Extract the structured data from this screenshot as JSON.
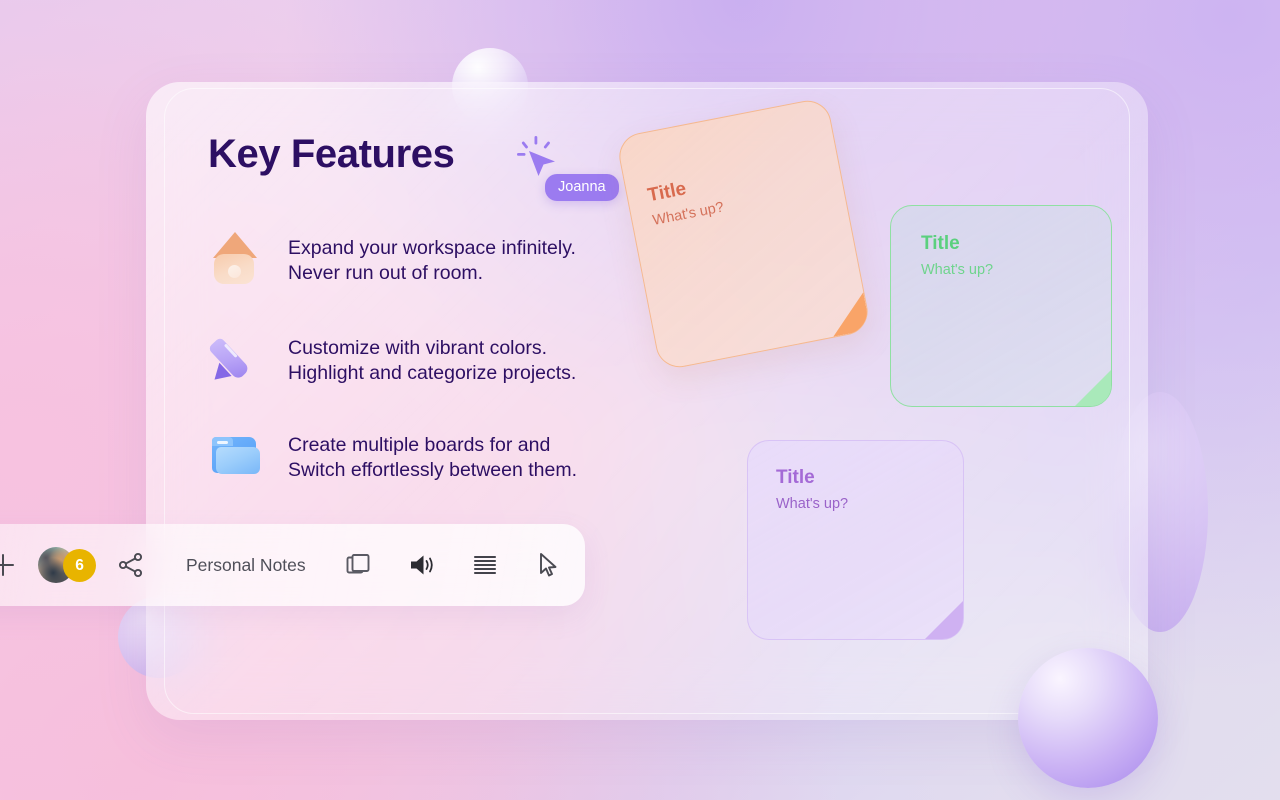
{
  "canvas": {
    "title": "Key Features",
    "features": [
      {
        "icon": "house-icon",
        "text": "Expand your workspace infinitely.\nNever run out of room."
      },
      {
        "icon": "pencil-icon",
        "text": "Customize with vibrant colors.\nHighlight and categorize projects."
      },
      {
        "icon": "folder-icon",
        "text": "Create multiple boards for and\nSwitch effortlessly between them."
      }
    ]
  },
  "collaborator_cursor": {
    "name": "Joanna",
    "pill_color": "#9b7bf0"
  },
  "sticky_notes": [
    {
      "id": "orange",
      "title": "Title",
      "body": "What's up?",
      "accent": "#f9a468",
      "title_color": "#d86a4e",
      "rotation": "-11deg"
    },
    {
      "id": "green",
      "title": "Title",
      "body": "What's up?",
      "accent": "#8fe0a2",
      "title_color": "#5bd07e",
      "rotation": "0deg"
    },
    {
      "id": "purple",
      "title": "Title",
      "body": "What's up?",
      "accent": "#cfb1f2",
      "title_color": "#a46ad6",
      "rotation": "0deg"
    }
  ],
  "toolbar": {
    "add_icon": "plus-icon",
    "avatar": "user-avatar",
    "collaborator_count": "6",
    "count_badge_color": "#e8b400",
    "share_icon": "share-icon",
    "board_name": "Personal Notes",
    "tools": [
      {
        "icon": "duplicate-icon"
      },
      {
        "icon": "volume-icon"
      },
      {
        "icon": "list-lines-icon"
      },
      {
        "icon": "pointer-icon"
      }
    ]
  },
  "theme": {
    "heading_color": "#2d0f63",
    "body_color": "#2d0f63",
    "accent": "#9b7bf0"
  }
}
